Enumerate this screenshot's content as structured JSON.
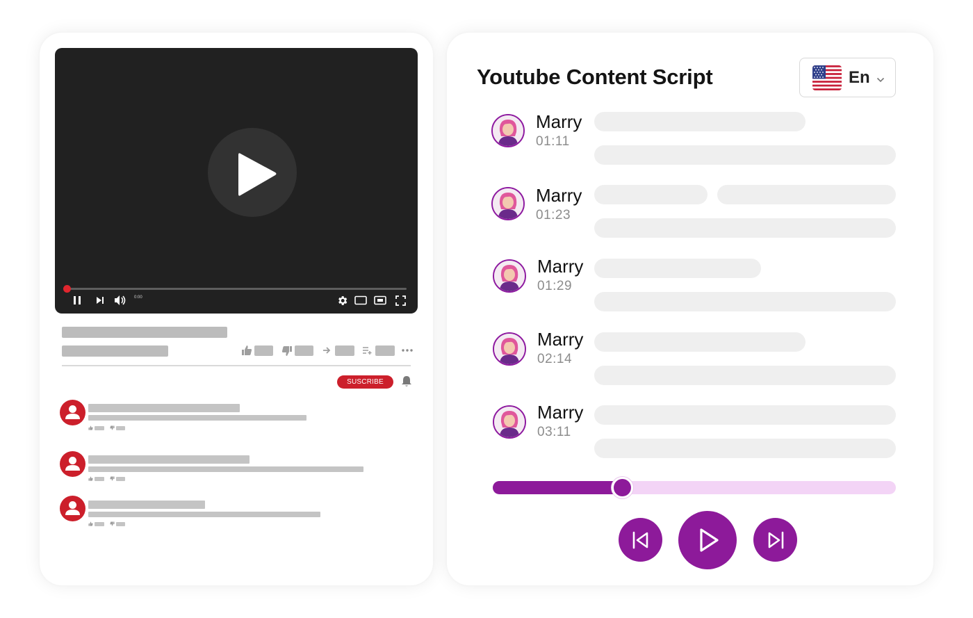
{
  "left_panel": {
    "player": {
      "time": "0:00",
      "progress": 0.0
    },
    "subscribe_label": "SUSCRIBE"
  },
  "right_panel": {
    "title": "Youtube Content Script",
    "language": {
      "code": "En",
      "flag": "us-flag-icon"
    },
    "entries": [
      {
        "speaker": "Marry",
        "time": "01:11"
      },
      {
        "speaker": "Marry",
        "time": "01:23"
      },
      {
        "speaker": "Marry",
        "time": "01:29"
      },
      {
        "speaker": "Marry",
        "time": "02:14"
      },
      {
        "speaker": "Marry",
        "time": "03:11"
      }
    ],
    "playback_progress": 0.32,
    "colors": {
      "accent": "#8d1a9a",
      "track": "#f3d4f6",
      "youtube_red": "#cc1f2b"
    }
  }
}
